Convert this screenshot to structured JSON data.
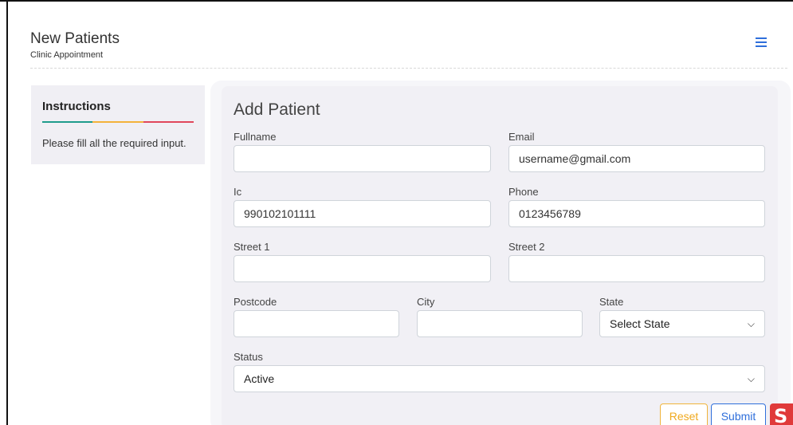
{
  "header": {
    "title": "New Patients",
    "subtitle": "Clinic Appointment"
  },
  "instructions": {
    "title": "Instructions",
    "text": "Please fill all the required input.",
    "line_colors": [
      "#1f9c8c",
      "#f3b23b",
      "#e0475b"
    ]
  },
  "form": {
    "title": "Add Patient",
    "fields": {
      "fullname": {
        "label": "Fullname",
        "value": ""
      },
      "email": {
        "label": "Email",
        "value": "username@gmail.com"
      },
      "ic": {
        "label": "Ic",
        "value": "990102101111"
      },
      "phone": {
        "label": "Phone",
        "value": "0123456789"
      },
      "street1": {
        "label": "Street 1",
        "value": ""
      },
      "street2": {
        "label": "Street 2",
        "value": ""
      },
      "postcode": {
        "label": "Postcode",
        "value": ""
      },
      "city": {
        "label": "City",
        "value": ""
      },
      "state": {
        "label": "State",
        "selected": "Select State"
      },
      "status": {
        "label": "Status",
        "selected": "Active"
      }
    },
    "buttons": {
      "reset": "Reset",
      "submit": "Submit"
    }
  },
  "icons": {
    "menu": "hamburger-icon",
    "chevron": "chevron-down-icon",
    "corner": "app-logo-icon"
  },
  "colors": {
    "primary": "#2f6fdb",
    "warning": "#f0a91e",
    "brand": "#e03a3a"
  }
}
